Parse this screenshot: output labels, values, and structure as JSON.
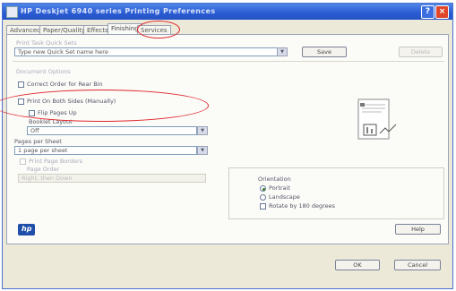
{
  "window": {
    "title": "HP Deskjet 6940 series Printing Preferences",
    "help_glyph": "?",
    "close_glyph": "×"
  },
  "tabs": [
    "Advanced",
    "Paper/Quality",
    "Effects",
    "Finishing",
    "Services"
  ],
  "quick_sets": {
    "label": "Print Task Quick Sets",
    "value": "Type new Quick Set name here",
    "save_label": "Save",
    "delete_label": "Delete"
  },
  "document_options": {
    "label": "Document Options",
    "correct_order_label": "Correct Order for Rear Bin",
    "print_both_sides_label": "Print On Both Sides (Manually)",
    "flip_pages_label": "Flip Pages Up",
    "booklet_layout_label": "Booklet Layout",
    "booklet_layout_value": "Off",
    "pages_per_sheet_label": "Pages per Sheet",
    "pages_per_sheet_value": "1 page per sheet",
    "print_page_borders_label": "Print Page Borders",
    "page_order_label": "Page Order",
    "page_order_value": "Right, then Down"
  },
  "orientation": {
    "label": "Orientation",
    "portrait_label": "Portrait",
    "landscape_label": "Landscape",
    "rotate_label": "Rotate by 180 degrees",
    "selected": "Portrait"
  },
  "footer": {
    "help_label": "Help",
    "ok_label": "OK",
    "cancel_label": "Cancel",
    "brand_icon": "hp-logo-icon"
  },
  "colors": {
    "annotation": "#e0252b",
    "title_bar": "#2a5bd2"
  }
}
